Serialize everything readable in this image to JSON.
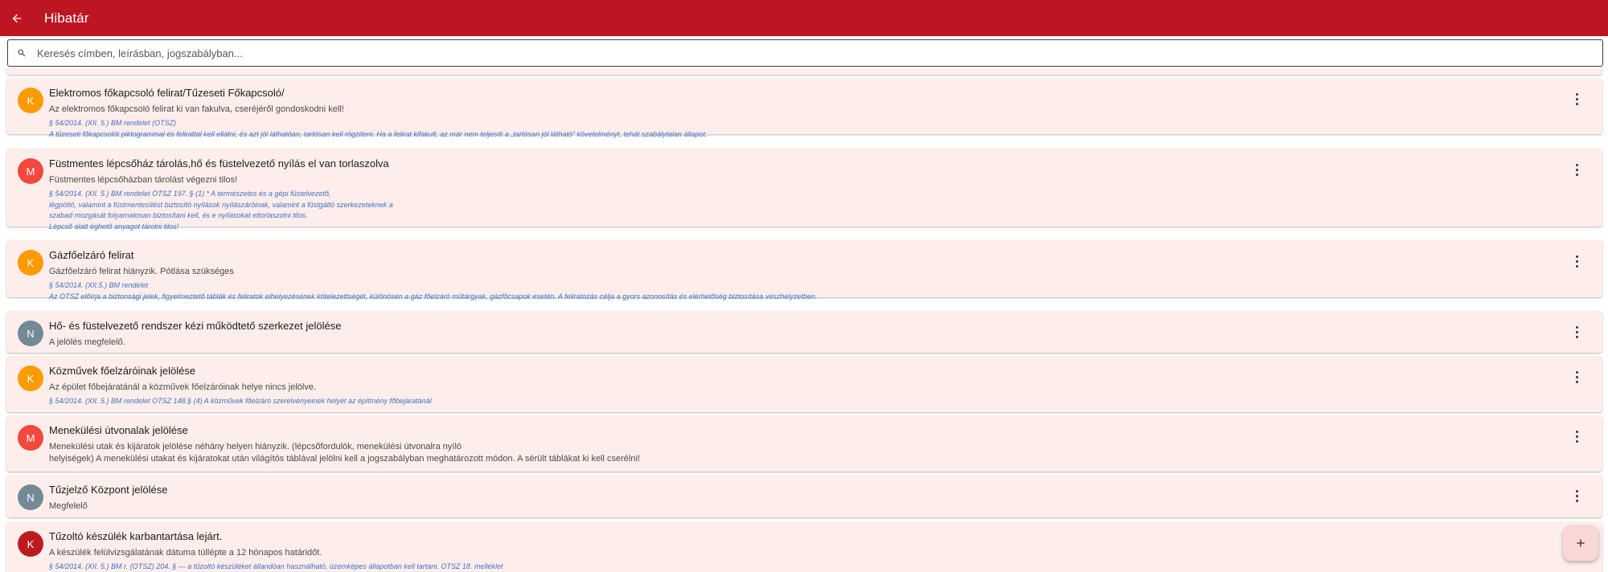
{
  "appbar": {
    "title": "Hibatár",
    "back_icon": "arrow-back-icon"
  },
  "search": {
    "placeholder": "Keresés címben, leírásban, jogszabályban...",
    "value": "",
    "icon": "search-icon"
  },
  "colors": {
    "appbar": "#bd1622",
    "card_bg": "#fdeeec",
    "avatar_K": "#fb9b00",
    "avatar_M": "#f3483d",
    "avatar_N": "#738a96",
    "avatar_K_dark": "#bb1b1f",
    "legal_text": "#3f6fc2"
  },
  "items": [
    {
      "avatar": "K",
      "title": "Elektromos főkapcsoló felirat/Tűzeseti Főkapcsoló/",
      "description": "Az elektromos főkapcsoló felirat ki van fakulva, cseréjéről gondoskodni kell!",
      "legal": "§ 54/2014. (XII. 5.) BM rendelet (OTSZ)\nA tűzeseti főkapcsolót piktogrammal és felirattal kell ellátni, és azt jól láthatóan, tartósan kell rögzíteni. Ha a felirat kifakult, az már nem teljesíti a „tartósan jól látható” követelményt, tehát szabálytalan állapot."
    },
    {
      "avatar": "M",
      "title": "Füstmentes lépcsőház tárolás,hő és füstelvezető nyílás el van torlaszolva",
      "description": "Füstmentes lépcsőházban tárolást végezni tilos!",
      "legal": "§ 54/2014. (XII. 5.) BM rendelet OTSZ 197. § (1) * A természetes és a gépi füstelvezető,\nlégpótló, valamint a füstmentesítést biztosító nyílások nyílászáróinak, valamint a füstgátló szerkezeteknek a\nszabad mozgását folyamatosan biztosítani kell, és e nyílásokat eltorlaszolni tilos.\nLépcső alatt éghető anyagot tárolni tilos!"
    },
    {
      "avatar": "K",
      "title": "Gázfőelzáró felirat",
      "description": "Gázfőelzáró felirat hiányzik. Pótlása szükséges",
      "legal": "§ 54/2014. (XII.5.) BM rendelet\nAz OTSZ előírja a biztonsági jelek, figyelmeztető táblák és feliratok elhelyezésének kötelezettségét, különösen a gáz főelzáró műtárgyak, gázfőcsapok esetén. A feliratozás célja a gyors azonosítás és elérhetőség biztosítása vészhelyzetben."
    },
    {
      "avatar": "N",
      "title": "Hő- és füstelvezető rendszer kézi működtető szerkezet jelölése",
      "description": "A jelölés megfelelő.",
      "legal": ""
    },
    {
      "avatar": "K",
      "title": "Közművek főelzáróinak jelölése",
      "description": "Az épület főbejáratánál a közművek főelzáróinak helye nincs jelölve.",
      "legal": "§ 54/2014. (XII. 5.) BM rendelet OTSZ 148.§ (4) A közművek főelzáró szerelvényeinek helyét az építmény főbejáratánál"
    },
    {
      "avatar": "M",
      "title": "Menekülési útvonalak jelölése",
      "description": "Menekülési utak és kijáratok jelölése néhány helyen hiányzik. (lépcsőfordulók, menekülési útvonalra nyíló\nhelyiségek) A menekülési utakat és kijáratokat után világítós táblával jelölni kell a jogszabályban meghatározott módon. A sérült táblákat ki kell cserélni!",
      "legal": ""
    },
    {
      "avatar": "N",
      "title": "Tűzjelző Központ jelölése",
      "description": "Megfelelő",
      "legal": ""
    },
    {
      "avatar": "K",
      "title": "Tűzoltó készülék karbantartása lejárt.",
      "description": "A készülék felülvizsgálatának dátuma túllépte a 12 hónapos határidőt.",
      "legal": "§ 54/2014. (XII. 5.) BM r. (OTSZ) 204. § — a tűzoltó készüléket állandóan használható, üzemképes állapotban kell tartani. OTSZ 18. melléklet"
    }
  ],
  "fab": {
    "icon": "plus-icon"
  }
}
